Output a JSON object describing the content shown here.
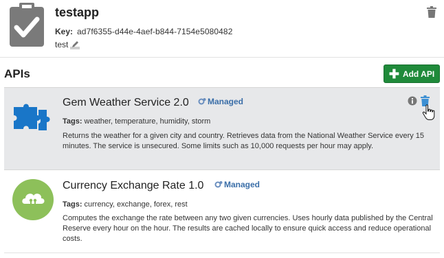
{
  "app": {
    "name": "testapp",
    "key_label": "Key:",
    "key_value": "ad7f6355-d44e-4aef-b844-7154e5080482",
    "description": "test"
  },
  "apis_section": {
    "title": "APIs",
    "add_button_label": "Add API"
  },
  "apis": [
    {
      "name": "Gem Weather Service 2.0",
      "status": "Managed",
      "tags_label": "Tags:",
      "tags": "weather, temperature, humidity, storm",
      "description": "Returns the weather for a given city and country. Retrieves data from the National Weather Service every 15 minutes. The service is unsecured. Some limits such as 10,000 requests per hour may apply.",
      "logo": "puzzle-icon"
    },
    {
      "name": "Currency Exchange Rate 1.0",
      "status": "Managed",
      "tags_label": "Tags:",
      "tags": "currency, exchange, forex, rest",
      "description": "Computes the exchange the rate between any two given currencies. Uses hourly data published by the Central Reserve every hour on the hour. The results are cached locally to ensure quick access and reduce operational costs.",
      "logo": "cloud-icon"
    }
  ],
  "colors": {
    "accent_green": "#1f8a3a",
    "managed_blue": "#3a6ea8",
    "puzzle_blue": "#1976c8",
    "cloud_green": "#8dc05a",
    "hover_bg": "#e7e8ea"
  }
}
